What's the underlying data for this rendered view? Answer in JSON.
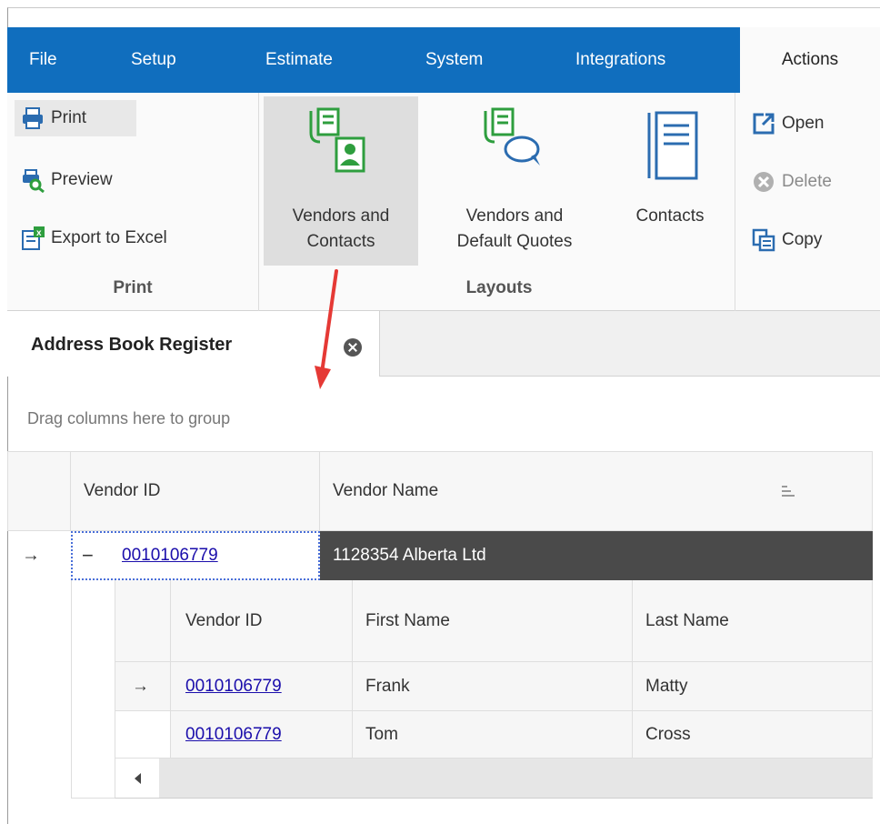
{
  "ribbon_tabs": [
    "File",
    "Setup",
    "Estimate",
    "System",
    "Integrations",
    "Actions"
  ],
  "print_group": {
    "label": "Print",
    "print": "Print",
    "preview": "Preview",
    "export": "Export to Excel"
  },
  "layouts_group": {
    "label": "Layouts",
    "vendors_contacts_1": "Vendors and",
    "vendors_contacts_2": "Contacts",
    "vendors_quotes_1": "Vendors and",
    "vendors_quotes_2": "Default Quotes",
    "contacts": "Contacts"
  },
  "actions_group": {
    "open": "Open",
    "delete": "Delete",
    "copy": "Copy"
  },
  "document_tab": "Address Book Register",
  "group_hint": "Drag columns here to group",
  "grid": {
    "headers": {
      "vendor_id": "Vendor ID",
      "vendor_name": "Vendor Name"
    },
    "master_row": {
      "vendor_id": "0010106779",
      "vendor_name": "1128354 Alberta Ltd"
    },
    "detail_headers": {
      "vendor_id": "Vendor ID",
      "first_name": "First Name",
      "last_name": "Last Name"
    },
    "detail_rows": [
      {
        "vendor_id": "0010106779",
        "first_name": "Frank",
        "last_name": "Matty"
      },
      {
        "vendor_id": "0010106779",
        "first_name": "Tom",
        "last_name": "Cross"
      }
    ]
  },
  "colors": {
    "ribbon_blue": "#106ebe",
    "annotation_red": "#e53935",
    "selected_row": "#4a4a4a"
  }
}
